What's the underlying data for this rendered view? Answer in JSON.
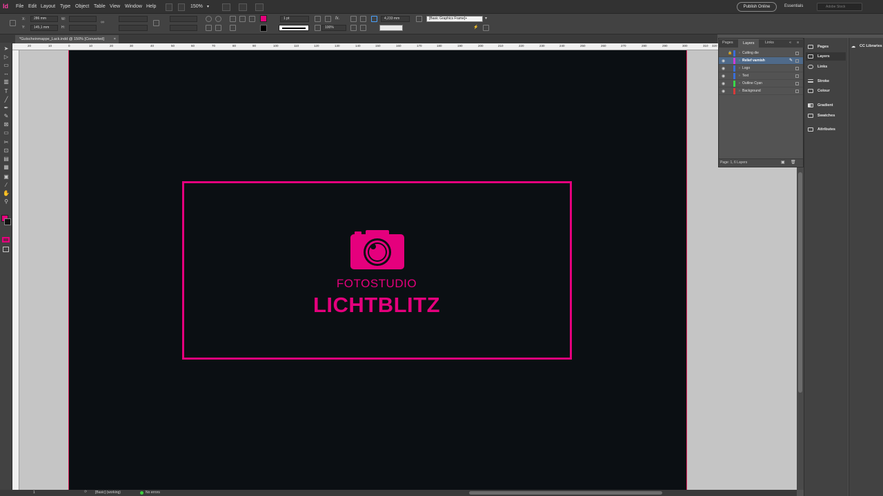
{
  "app": {
    "logo_text": "Id"
  },
  "menubar": {
    "items": [
      "File",
      "Edit",
      "Layout",
      "Type",
      "Object",
      "Table",
      "View",
      "Window",
      "Help"
    ],
    "zoom": "150%",
    "publish_label": "Publish Online",
    "workspace": "Essentials",
    "stock_search_placeholder": "Adobe Stock"
  },
  "controlbar": {
    "x_label": "X:",
    "x_value": "286 mm",
    "y_label": "Y:",
    "y_value": "145,1 mm",
    "w_label": "W:",
    "h_label": "H:",
    "stroke_weight": "1 pt",
    "opacity": "100%",
    "dimension": "4,233 mm",
    "object_style": "[Basic Graphics Frame]+",
    "fill_color": "#e5007d",
    "stroke_color": "#000000"
  },
  "document": {
    "tab_title": "*Gutscheinmappe_Lack.indd @ 150% [Converted]",
    "ruler_labels": [
      "20",
      "10",
      "0",
      "10",
      "20",
      "30",
      "40",
      "50",
      "60",
      "70",
      "80",
      "90",
      "100",
      "110",
      "120",
      "130",
      "140",
      "150",
      "160",
      "170",
      "180",
      "190",
      "200",
      "210",
      "220",
      "230",
      "240",
      "250",
      "260",
      "270",
      "280",
      "290",
      "300",
      "310",
      "320"
    ]
  },
  "artwork": {
    "brand_top": "FOTOSTUDIO",
    "brand_main": "LICHTBLITZ",
    "brand_color": "#e5007d",
    "page_color": "#0b0f13"
  },
  "statusbar": {
    "page": "1",
    "preflight_profile": "[Basic] (working)",
    "errors": "No errors"
  },
  "layers_panel": {
    "tabs": [
      "Pages",
      "Layers",
      "Links"
    ],
    "active_tab": "Layers",
    "layers": [
      {
        "name": "Cutting die",
        "color": "#3a6ed8",
        "visible": false,
        "locked": true
      },
      {
        "name": "Relief varnish",
        "color": "#d03bd8",
        "visible": true,
        "selected": true
      },
      {
        "name": "Logo",
        "color": "#3a6ed8",
        "visible": true
      },
      {
        "name": "Text",
        "color": "#3a6ed8",
        "visible": true
      },
      {
        "name": "Outline Cyan",
        "color": "#3ad84a",
        "visible": true
      },
      {
        "name": "Background",
        "color": "#d83a3a",
        "visible": true
      }
    ],
    "footer": "Page: 1, 6 Layers"
  },
  "dock": {
    "items": [
      "Pages",
      "Layers",
      "Links",
      "Stroke",
      "Colour",
      "Gradient",
      "Swatches",
      "Attributes"
    ],
    "cc_libraries": "CC Libraries"
  }
}
